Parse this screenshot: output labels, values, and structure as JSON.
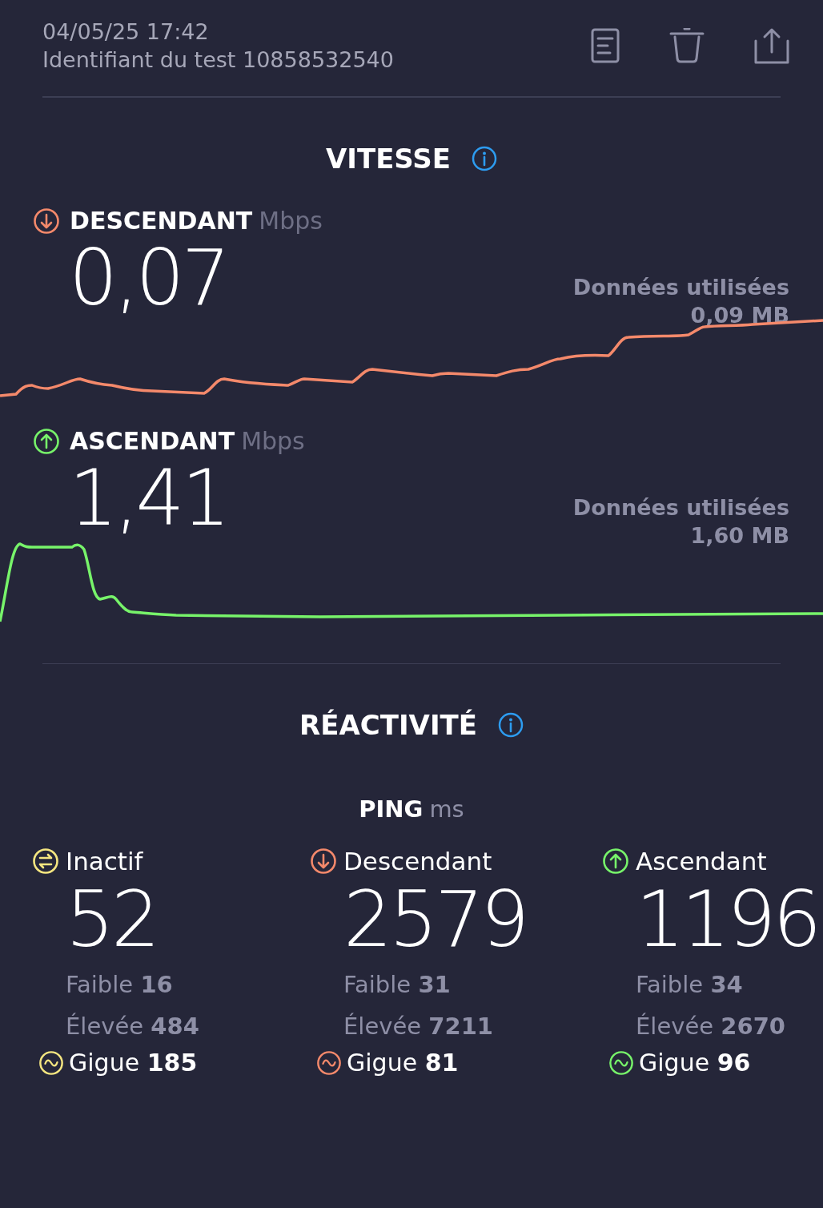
{
  "header": {
    "date": "04/05/25 17:42",
    "test_id": "Identifiant du test 10858532540"
  },
  "speed": {
    "title": "VITESSE",
    "sections": [
      {
        "kind": "download",
        "label": "DESCENDANT",
        "unit": "Mbps",
        "value": "0,07",
        "data_label": "Données utilisées",
        "data_value": "0,09 MB"
      },
      {
        "kind": "upload",
        "label": "ASCENDANT",
        "unit": "Mbps",
        "value": "1,41",
        "data_label": "Données utilisées",
        "data_value": "1,60 MB"
      }
    ]
  },
  "responsiveness": {
    "title": "RÉACTIVITÉ",
    "ping_label": "PING",
    "ping_unit": "ms",
    "columns": [
      {
        "kind": "idle",
        "label": "Inactif",
        "value": "52",
        "low_label": "Faible",
        "low": "16",
        "high_label": "Élevée",
        "high": "484",
        "jitter_label": "Gigue",
        "jitter": "185"
      },
      {
        "kind": "download",
        "label": "Descendant",
        "value": "2579",
        "low_label": "Faible",
        "low": "31",
        "high_label": "Élevée",
        "high": "7211",
        "jitter_label": "Gigue",
        "jitter": "81"
      },
      {
        "kind": "upload",
        "label": "Ascendant",
        "value": "1196",
        "low_label": "Faible",
        "low": "34",
        "high_label": "Élevée",
        "high": "2670",
        "jitter_label": "Gigue",
        "jitter": "96"
      }
    ]
  }
}
